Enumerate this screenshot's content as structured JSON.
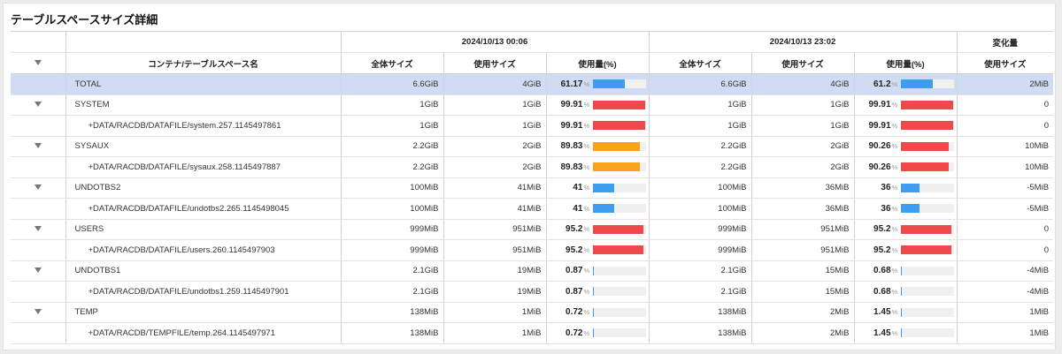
{
  "title": "テーブルスペースサイズ詳細",
  "colors": {
    "blue": "#3d9ef0",
    "orange": "#f9a21e",
    "red": "#ef4a4b",
    "total_row_bg": "#cfdcf4"
  },
  "header": {
    "group1": "2024/10/13 00:06",
    "group2": "2024/10/13 23:02",
    "group3": "変化量",
    "col_name": "コンテナ/テーブルスペース名",
    "total_size": "全体サイズ",
    "used_size": "使用サイズ",
    "usage_pct": "使用量(%)",
    "pct_symbol": "%"
  },
  "rows": [
    {
      "type": "total",
      "name": "TOTAL",
      "t1_total": "6.6GiB",
      "t1_used": "4GiB",
      "t1_pct": "61.17",
      "t1_pct_value": 61.17,
      "t1_color": "#3d9ef0",
      "t2_total": "6.6GiB",
      "t2_used": "4GiB",
      "t2_pct": "61.2",
      "t2_pct_value": 61.2,
      "t2_color": "#3d9ef0",
      "change": "2MiB"
    },
    {
      "type": "parent",
      "name": "SYSTEM",
      "t1_total": "1GiB",
      "t1_used": "1GiB",
      "t1_pct": "99.91",
      "t1_pct_value": 99.91,
      "t1_color": "#ef4a4b",
      "t2_total": "1GiB",
      "t2_used": "1GiB",
      "t2_pct": "99.91",
      "t2_pct_value": 99.91,
      "t2_color": "#ef4a4b",
      "change": "0"
    },
    {
      "type": "child",
      "name": "+DATA/RACDB/DATAFILE/system.257.1145497861",
      "t1_total": "1GiB",
      "t1_used": "1GiB",
      "t1_pct": "99.91",
      "t1_pct_value": 99.91,
      "t1_color": "#ef4a4b",
      "t2_total": "1GiB",
      "t2_used": "1GiB",
      "t2_pct": "99.91",
      "t2_pct_value": 99.91,
      "t2_color": "#ef4a4b",
      "change": "0"
    },
    {
      "type": "parent",
      "name": "SYSAUX",
      "t1_total": "2.2GiB",
      "t1_used": "2GiB",
      "t1_pct": "89.83",
      "t1_pct_value": 89.83,
      "t1_color": "#f9a21e",
      "t2_total": "2.2GiB",
      "t2_used": "2GiB",
      "t2_pct": "90.26",
      "t2_pct_value": 90.26,
      "t2_color": "#ef4a4b",
      "change": "10MiB"
    },
    {
      "type": "child",
      "name": "+DATA/RACDB/DATAFILE/sysaux.258.1145497887",
      "t1_total": "2.2GiB",
      "t1_used": "2GiB",
      "t1_pct": "89.83",
      "t1_pct_value": 89.83,
      "t1_color": "#f9a21e",
      "t2_total": "2.2GiB",
      "t2_used": "2GiB",
      "t2_pct": "90.26",
      "t2_pct_value": 90.26,
      "t2_color": "#ef4a4b",
      "change": "10MiB"
    },
    {
      "type": "parent",
      "name": "UNDOTBS2",
      "t1_total": "100MiB",
      "t1_used": "41MiB",
      "t1_pct": "41",
      "t1_pct_value": 41,
      "t1_color": "#3d9ef0",
      "t2_total": "100MiB",
      "t2_used": "36MiB",
      "t2_pct": "36",
      "t2_pct_value": 36,
      "t2_color": "#3d9ef0",
      "change": "-5MiB"
    },
    {
      "type": "child",
      "name": "+DATA/RACDB/DATAFILE/undotbs2.265.1145498045",
      "t1_total": "100MiB",
      "t1_used": "41MiB",
      "t1_pct": "41",
      "t1_pct_value": 41,
      "t1_color": "#3d9ef0",
      "t2_total": "100MiB",
      "t2_used": "36MiB",
      "t2_pct": "36",
      "t2_pct_value": 36,
      "t2_color": "#3d9ef0",
      "change": "-5MiB"
    },
    {
      "type": "parent",
      "name": "USERS",
      "t1_total": "999MiB",
      "t1_used": "951MiB",
      "t1_pct": "95.2",
      "t1_pct_value": 95.2,
      "t1_color": "#ef4a4b",
      "t2_total": "999MiB",
      "t2_used": "951MiB",
      "t2_pct": "95.2",
      "t2_pct_value": 95.2,
      "t2_color": "#ef4a4b",
      "change": "0"
    },
    {
      "type": "child",
      "name": "+DATA/RACDB/DATAFILE/users.260.1145497903",
      "t1_total": "999MiB",
      "t1_used": "951MiB",
      "t1_pct": "95.2",
      "t1_pct_value": 95.2,
      "t1_color": "#ef4a4b",
      "t2_total": "999MiB",
      "t2_used": "951MiB",
      "t2_pct": "95.2",
      "t2_pct_value": 95.2,
      "t2_color": "#ef4a4b",
      "change": "0"
    },
    {
      "type": "parent",
      "name": "UNDOTBS1",
      "t1_total": "2.1GiB",
      "t1_used": "19MiB",
      "t1_pct": "0.87",
      "t1_pct_value": 0.87,
      "t1_color": "#3d9ef0",
      "t2_total": "2.1GiB",
      "t2_used": "15MiB",
      "t2_pct": "0.68",
      "t2_pct_value": 0.68,
      "t2_color": "#3d9ef0",
      "change": "-4MiB"
    },
    {
      "type": "child",
      "name": "+DATA/RACDB/DATAFILE/undotbs1.259.1145497901",
      "t1_total": "2.1GiB",
      "t1_used": "19MiB",
      "t1_pct": "0.87",
      "t1_pct_value": 0.87,
      "t1_color": "#3d9ef0",
      "t2_total": "2.1GiB",
      "t2_used": "15MiB",
      "t2_pct": "0.68",
      "t2_pct_value": 0.68,
      "t2_color": "#3d9ef0",
      "change": "-4MiB"
    },
    {
      "type": "parent",
      "name": "TEMP",
      "t1_total": "138MiB",
      "t1_used": "1MiB",
      "t1_pct": "0.72",
      "t1_pct_value": 0.72,
      "t1_color": "#3d9ef0",
      "t2_total": "138MiB",
      "t2_used": "2MiB",
      "t2_pct": "1.45",
      "t2_pct_value": 1.45,
      "t2_color": "#3d9ef0",
      "change": "1MiB"
    },
    {
      "type": "child",
      "name": "+DATA/RACDB/TEMPFILE/temp.264.1145497971",
      "t1_total": "138MiB",
      "t1_used": "1MiB",
      "t1_pct": "0.72",
      "t1_pct_value": 0.72,
      "t1_color": "#3d9ef0",
      "t2_total": "138MiB",
      "t2_used": "2MiB",
      "t2_pct": "1.45",
      "t2_pct_value": 1.45,
      "t2_color": "#3d9ef0",
      "change": "1MiB"
    }
  ]
}
